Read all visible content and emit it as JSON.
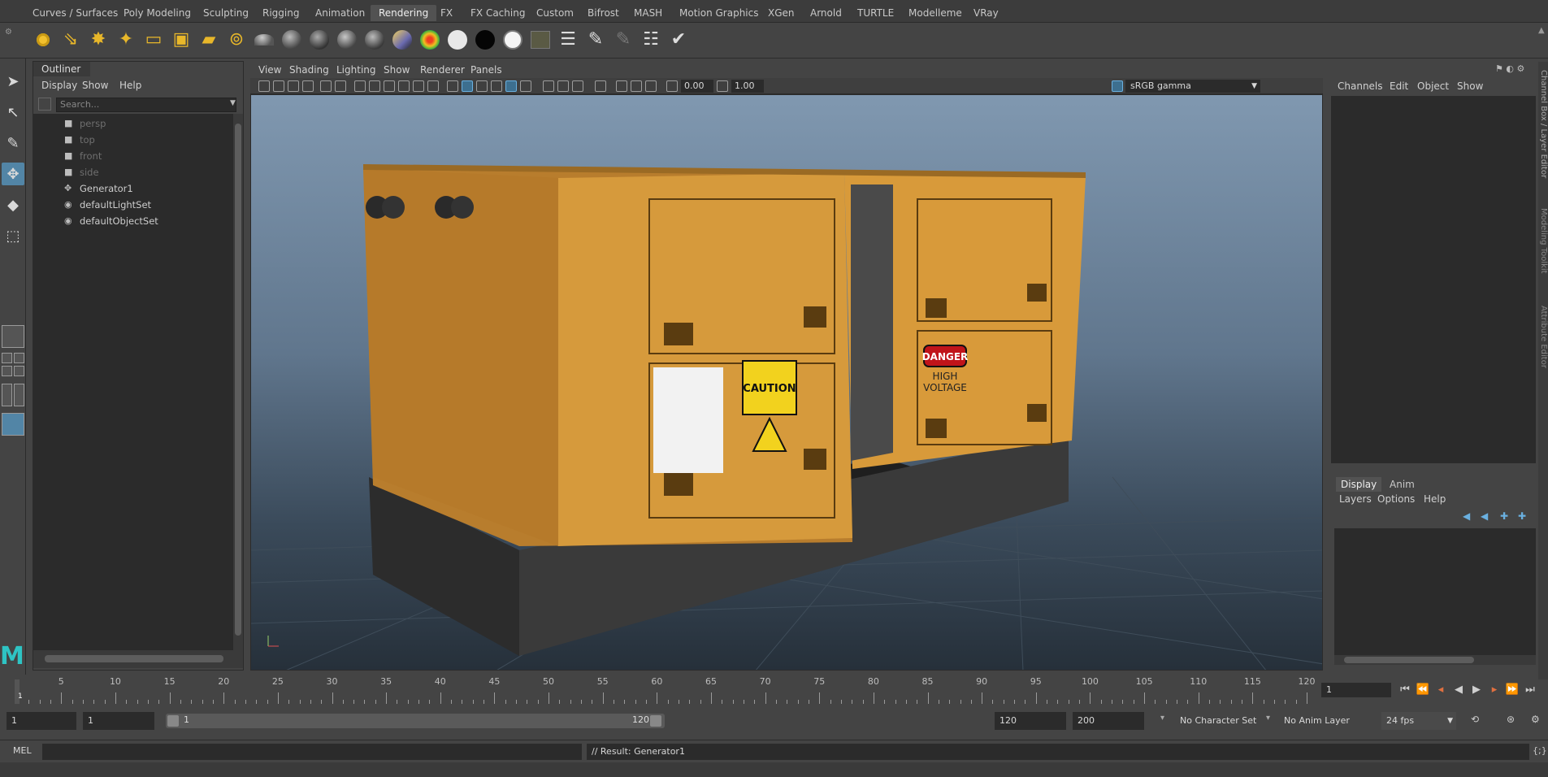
{
  "shelf_tabs": [
    {
      "label": "Curves / Surfaces",
      "active": false
    },
    {
      "label": "Poly Modeling",
      "active": false
    },
    {
      "label": "Sculpting",
      "active": false
    },
    {
      "label": "Rigging",
      "active": false
    },
    {
      "label": "Animation",
      "active": false
    },
    {
      "label": "Rendering",
      "active": true
    },
    {
      "label": "FX",
      "active": false
    },
    {
      "label": "FX Caching",
      "active": false
    },
    {
      "label": "Custom",
      "active": false
    },
    {
      "label": "Bifrost",
      "active": false
    },
    {
      "label": "MASH",
      "active": false
    },
    {
      "label": "Motion Graphics",
      "active": false
    },
    {
      "label": "XGen",
      "active": false
    },
    {
      "label": "Arnold",
      "active": false
    },
    {
      "label": "TURTLE",
      "active": false
    },
    {
      "label": "Modelleme",
      "active": false
    },
    {
      "label": "VRay",
      "active": false
    }
  ],
  "shelf_icons": [
    "ambient-light-icon",
    "directional-light-icon",
    "point-light-icon",
    "spot-light-icon",
    "area-light-icon",
    "volume-light-icon",
    "camera-icon",
    "camera-aim-icon",
    "blinn-material-icon",
    "lambert-material-icon",
    "phong-material-icon",
    "phonge-material-icon",
    "anisotropic-material-icon",
    "ramp-material-icon",
    "layered-texture-icon",
    "white-material-icon",
    "black-material-icon",
    "surface-material-icon",
    "render-view-icon",
    "render-settings-icon",
    "hypershade-icon",
    "ipr-render-icon",
    "batch-render-icon",
    "render-setup-icon"
  ],
  "outliner": {
    "title": "Outliner",
    "menu": [
      "Display",
      "Show",
      "Help"
    ],
    "search_placeholder": "Search...",
    "items": [
      {
        "label": "persp",
        "icon": "camera-icon",
        "dim": true
      },
      {
        "label": "top",
        "icon": "camera-icon",
        "dim": true
      },
      {
        "label": "front",
        "icon": "camera-icon",
        "dim": true
      },
      {
        "label": "side",
        "icon": "camera-icon",
        "dim": true
      },
      {
        "label": "Generator1",
        "icon": "transform-icon",
        "dim": false
      },
      {
        "label": "defaultLightSet",
        "icon": "set-icon",
        "dim": false
      },
      {
        "label": "defaultObjectSet",
        "icon": "set-icon",
        "dim": false
      }
    ]
  },
  "viewport": {
    "menu": [
      "View",
      "Shading",
      "Lighting",
      "Show",
      "Renderer",
      "Panels"
    ],
    "exposure": "0.00",
    "gamma": "1.00",
    "color_space": "sRGB gamma",
    "model_name": "Generator1",
    "signs": {
      "caution": "CAUTION",
      "danger": "DANGER",
      "high_voltage_1": "HIGH",
      "high_voltage_2": "VOLTAGE"
    }
  },
  "channel_box": {
    "menu": [
      "Channels",
      "Edit",
      "Object",
      "Show"
    ],
    "side_tabs": [
      "Channel Box / Layer Editor",
      "Modeling Toolkit",
      "Attribute Editor"
    ]
  },
  "layer_editor": {
    "tabs": [
      {
        "label": "Display",
        "active": true
      },
      {
        "label": "Anim",
        "active": false
      }
    ],
    "menu": [
      "Layers",
      "Options",
      "Help"
    ]
  },
  "timeline": {
    "labels": [
      "5",
      "10",
      "15",
      "20",
      "25",
      "30",
      "35",
      "40",
      "45",
      "50",
      "55",
      "60",
      "65",
      "70",
      "75",
      "80",
      "85",
      "90",
      "95",
      "100",
      "105",
      "110",
      "115",
      "120"
    ],
    "current_frame": "1",
    "frame_field": "1"
  },
  "range": {
    "start": "1",
    "playback_start": "1",
    "slider_start": "1",
    "slider_end": "120",
    "playback_end": "120",
    "end": "200",
    "character_set": "No Character Set",
    "anim_layer": "No Anim Layer",
    "fps": "24 fps"
  },
  "command_line": {
    "label": "MEL",
    "result": "// Result: Generator1"
  },
  "colors": {
    "accent": "#5285a6",
    "maya_logo": "#2ec4c4",
    "generator_body": "#d79a3a"
  }
}
